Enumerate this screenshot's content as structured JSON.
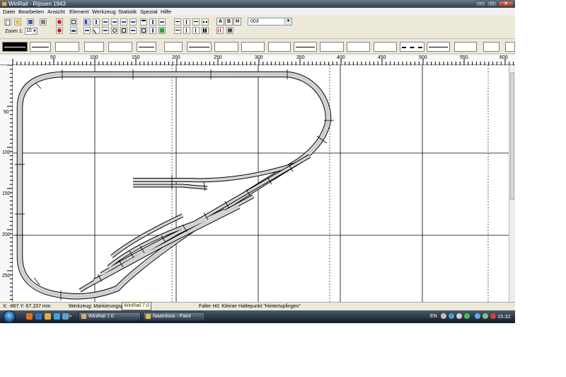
{
  "window": {
    "title": "WinRail - Rijssen 1943",
    "buttons": {
      "minimize": "–",
      "maximize": "□",
      "close": "✕"
    }
  },
  "menu": [
    "Datei",
    "Bearbeiten",
    "Ansicht",
    "Element",
    "Werkzeug",
    "Statistik",
    "Spezial",
    "Hilfe"
  ],
  "toolbar": {
    "zoom_label": "Zoom 1:",
    "zoom_value": "10",
    "layer_select": "003",
    "letter_buttons": [
      "A",
      "B",
      "H"
    ]
  },
  "rulers": {
    "horizontal": [
      "50",
      "100",
      "150",
      "200",
      "250",
      "300",
      "350",
      "400",
      "450",
      "500",
      "550",
      "600"
    ],
    "vertical": [
      "50",
      "100",
      "150",
      "200",
      "250"
    ]
  },
  "status": {
    "coords": "X: -867   Y: 67.157 mm",
    "tool": "Werkzeug: Markierungspf",
    "tooltip": "WinRail 7.0",
    "element": "Faller H0: Kleiner Haltepunkt \"Hintertupfingen\""
  },
  "taskbar": {
    "chevron": "»",
    "tasks": [
      "WinRail 7.0",
      "Naamloos - Paint"
    ],
    "language": "EN",
    "clock": "15:32"
  },
  "colors": {
    "titlebar": "#2c3d4e",
    "taskbar": "#111a24",
    "track_fill": "#d4d4d4",
    "grid": "#000000"
  }
}
